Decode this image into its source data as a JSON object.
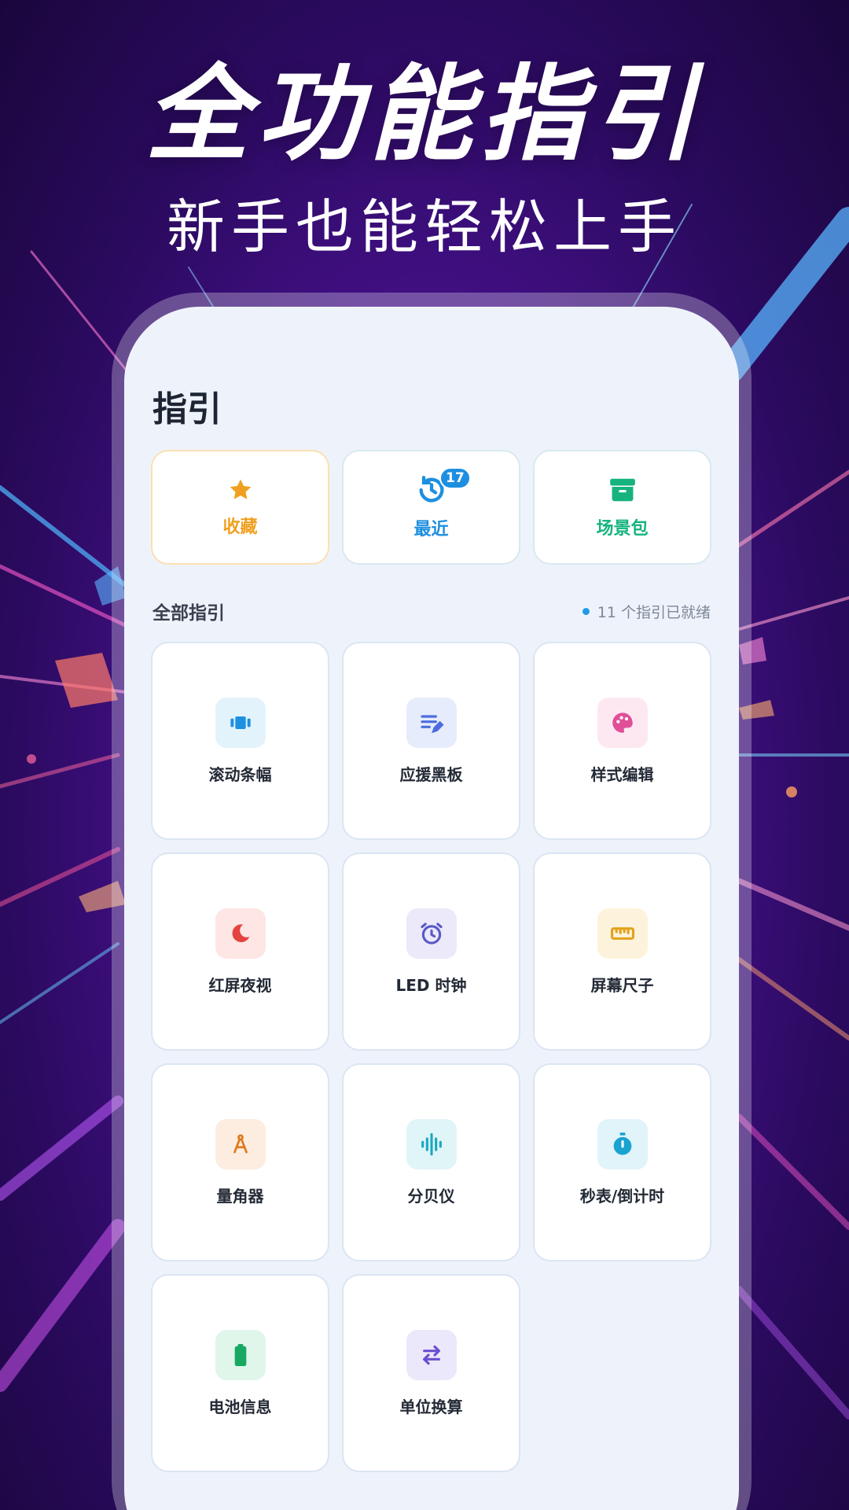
{
  "promo": {
    "title": "全功能指引",
    "subtitle": "新手也能轻松上手"
  },
  "page": {
    "title": "指引"
  },
  "quick_actions": [
    {
      "label": "收藏",
      "icon": "star-icon",
      "color": "#f0a020"
    },
    {
      "label": "最近",
      "icon": "history-icon",
      "color": "#1e8fe0",
      "badge": "17"
    },
    {
      "label": "场景包",
      "icon": "archive-icon",
      "color": "#16b37f"
    }
  ],
  "section": {
    "title": "全部指引",
    "status": "11 个指引已就绪"
  },
  "tools": [
    {
      "label": "滚动条幅",
      "icon": "scroll-banner-icon",
      "color": "#1e90e0",
      "bg": "#e3f3fc"
    },
    {
      "label": "应援黑板",
      "icon": "notes-edit-icon",
      "color": "#4c6de0",
      "bg": "#e6ecfb"
    },
    {
      "label": "样式编辑",
      "icon": "palette-icon",
      "color": "#e04f98",
      "bg": "#fde8f2"
    },
    {
      "label": "红屏夜视",
      "icon": "moon-icon",
      "color": "#e5433f",
      "bg": "#fde6e4"
    },
    {
      "label": "LED 时钟",
      "icon": "alarm-clock-icon",
      "color": "#5a58c8",
      "bg": "#ebe9fa"
    },
    {
      "label": "屏幕尺子",
      "icon": "ruler-icon",
      "color": "#e2a21c",
      "bg": "#fdf3dc"
    },
    {
      "label": "量角器",
      "icon": "compass-icon",
      "color": "#e07a1e",
      "bg": "#fdece0"
    },
    {
      "label": "分贝仪",
      "icon": "sound-wave-icon",
      "color": "#1aa8c0",
      "bg": "#e0f5f7"
    },
    {
      "label": "秒表/倒计时",
      "icon": "stopwatch-icon",
      "color": "#1aa2d0",
      "bg": "#e0f4fa"
    },
    {
      "label": "电池信息",
      "icon": "battery-icon",
      "color": "#18a862",
      "bg": "#e0f6ea"
    },
    {
      "label": "单位换算",
      "icon": "swap-icon",
      "color": "#6a4fd0",
      "bg": "#ece8fb"
    }
  ]
}
